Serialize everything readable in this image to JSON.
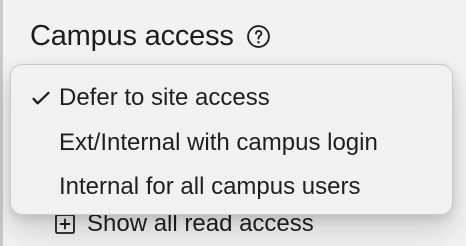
{
  "header": {
    "title": "Campus access",
    "help_icon": "question-circle-icon"
  },
  "dropdown": {
    "selected_index": 0,
    "items": [
      {
        "label": "Defer to site access",
        "checked": true
      },
      {
        "label": "Ext/Internal with campus login",
        "checked": false
      },
      {
        "label": "Internal for all campus users",
        "checked": false
      }
    ]
  },
  "footer": {
    "show_all_label": "Show all read access",
    "icon": "plus-square-icon"
  },
  "colors": {
    "background": "#f2f2f2",
    "menu_background": "#f0f0f0",
    "menu_border": "#c8c8c8",
    "text": "#1f1f1f"
  }
}
